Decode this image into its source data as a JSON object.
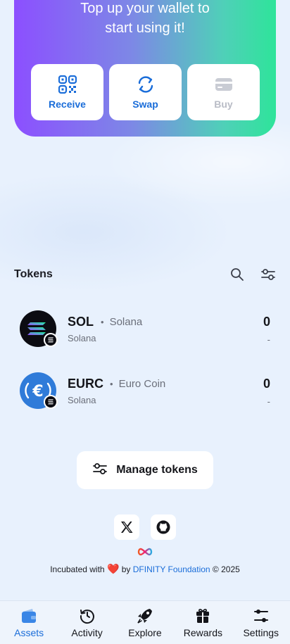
{
  "hero": {
    "line1": "Top up your wallet to",
    "line2": "start using it!",
    "actions": [
      {
        "label": "Receive",
        "icon": "qr-code-icon",
        "enabled": true
      },
      {
        "label": "Swap",
        "icon": "swap-icon",
        "enabled": true
      },
      {
        "label": "Buy",
        "icon": "card-icon",
        "enabled": false
      }
    ]
  },
  "tokens": {
    "title": "Tokens",
    "items": [
      {
        "symbol": "SOL",
        "name": "Solana",
        "network": "Solana",
        "balance": "0",
        "usd": "-"
      },
      {
        "symbol": "EURC",
        "name": "Euro Coin",
        "network": "Solana",
        "balance": "0",
        "usd": "-"
      }
    ]
  },
  "manage": {
    "label": "Manage tokens"
  },
  "footer": {
    "prefix": "Incubated with",
    "heart": "❤️",
    "by": "by",
    "link": "DFINITY Foundation",
    "copyright": "© 2025"
  },
  "nav": {
    "items": [
      {
        "label": "Assets",
        "icon": "wallet-icon",
        "active": true
      },
      {
        "label": "Activity",
        "icon": "history-icon",
        "active": false
      },
      {
        "label": "Explore",
        "icon": "rocket-icon",
        "active": false
      },
      {
        "label": "Rewards",
        "icon": "gift-icon",
        "active": false
      },
      {
        "label": "Settings",
        "icon": "sliders-icon",
        "active": false
      }
    ]
  },
  "colors": {
    "accent": "#1a6dd9",
    "background": "#e8f1fd",
    "gradient_start": "#8c4fff",
    "gradient_end": "#2ee49a"
  }
}
